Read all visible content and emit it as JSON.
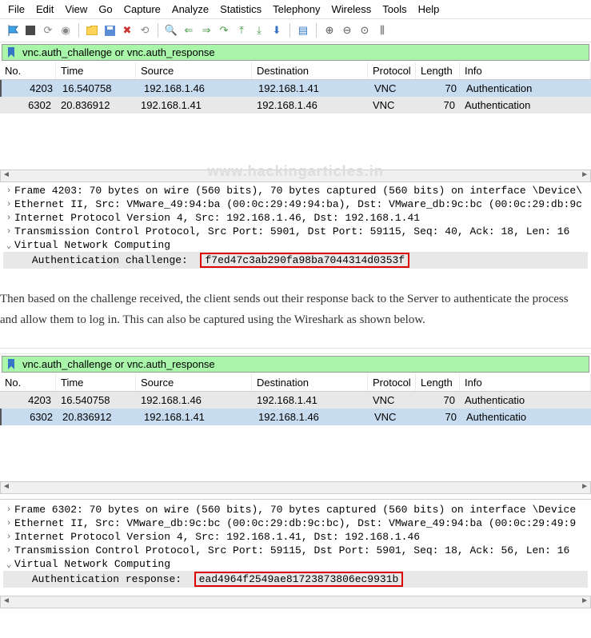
{
  "menu": [
    "File",
    "Edit",
    "View",
    "Go",
    "Capture",
    "Analyze",
    "Statistics",
    "Telephony",
    "Wireless",
    "Tools",
    "Help"
  ],
  "filter": "vnc.auth_challenge or vnc.auth_response",
  "columns": [
    "No.",
    "Time",
    "Source",
    "Destination",
    "Protocol",
    "Length",
    "Info"
  ],
  "watermark": "www.hackingarticles.in",
  "ws1": {
    "rows": [
      {
        "no": "4203",
        "time": "16.540758",
        "src": "192.168.1.46",
        "dst": "192.168.1.41",
        "proto": "VNC",
        "len": "70",
        "info": "Authentication"
      },
      {
        "no": "6302",
        "time": "20.836912",
        "src": "192.168.1.41",
        "dst": "192.168.1.46",
        "proto": "VNC",
        "len": "70",
        "info": "Authentication"
      }
    ],
    "tree": {
      "frame": "Frame 4203: 70 bytes on wire (560 bits), 70 bytes captured (560 bits) on interface \\Device\\",
      "eth": "Ethernet II, Src: VMware_49:94:ba (00:0c:29:49:94:ba), Dst: VMware_db:9c:bc (00:0c:29:db:9c",
      "ip": "Internet Protocol Version 4, Src: 192.168.1.46, Dst: 192.168.1.41",
      "tcp": "Transmission Control Protocol, Src Port: 5901, Dst Port: 59115, Seq: 40, Ack: 18, Len: 16",
      "vnc": "Virtual Network Computing",
      "auth_label": "Authentication challenge:",
      "auth_value": "f7ed47c3ab290fa98ba7044314d0353f"
    }
  },
  "article_p1": "Then based on the challenge received, the client sends out their response back to the Server to authenticate the process and allow them to log in. This can also be captured using the Wireshark as shown below.",
  "ws2": {
    "rows": [
      {
        "no": "4203",
        "time": "16.540758",
        "src": "192.168.1.46",
        "dst": "192.168.1.41",
        "proto": "VNC",
        "len": "70",
        "info": "Authenticatio"
      },
      {
        "no": "6302",
        "time": "20.836912",
        "src": "192.168.1.41",
        "dst": "192.168.1.46",
        "proto": "VNC",
        "len": "70",
        "info": "Authenticatio"
      }
    ],
    "tree": {
      "frame": "Frame 6302: 70 bytes on wire (560 bits), 70 bytes captured (560 bits) on interface \\Device",
      "eth": "Ethernet II, Src: VMware_db:9c:bc (00:0c:29:db:9c:bc), Dst: VMware_49:94:ba (00:0c:29:49:9",
      "ip": "Internet Protocol Version 4, Src: 192.168.1.41, Dst: 192.168.1.46",
      "tcp": "Transmission Control Protocol, Src Port: 59115, Dst Port: 5901, Seq: 18, Ack: 56, Len: 16",
      "vnc": "Virtual Network Computing",
      "auth_label": "Authentication response:",
      "auth_value": "ead4964f2549ae81723873806ec9931b"
    }
  }
}
